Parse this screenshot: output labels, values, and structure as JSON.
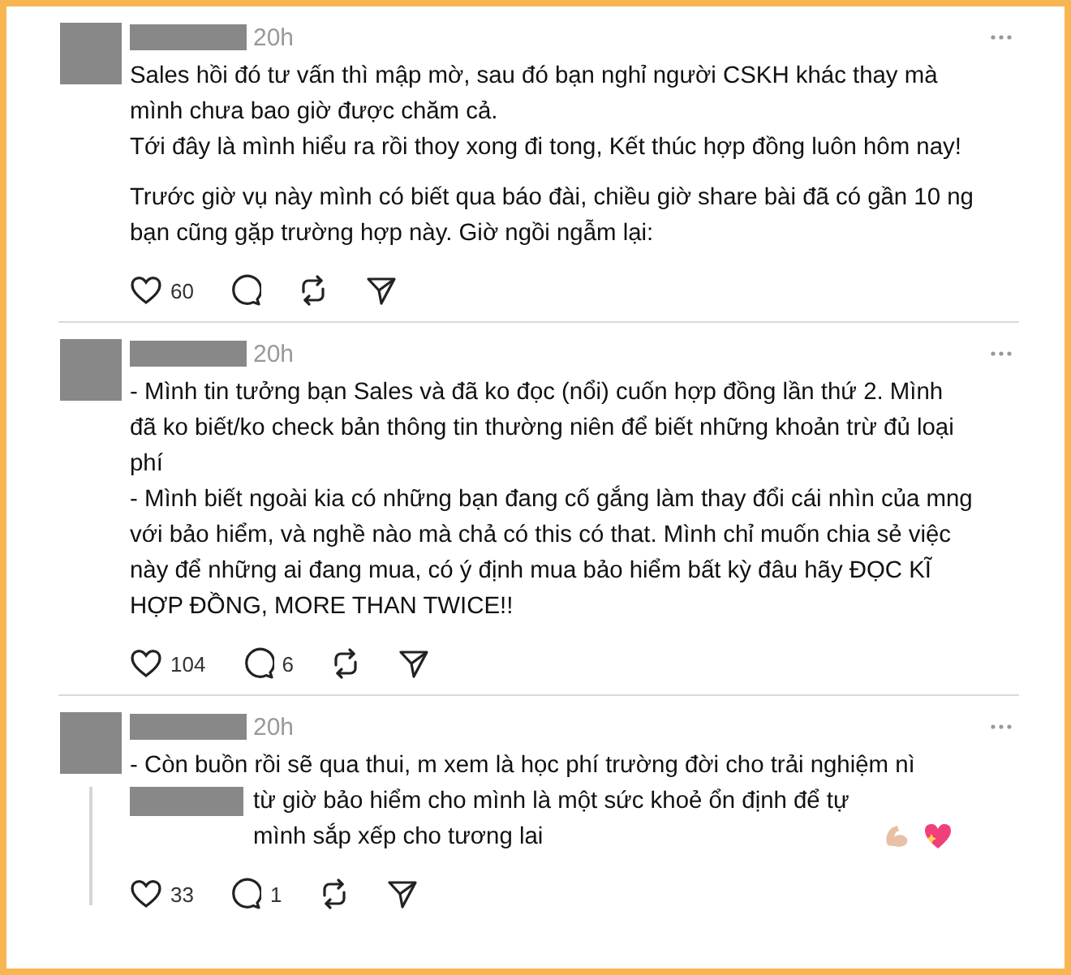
{
  "posts": [
    {
      "time": "20h",
      "has_thread_line": false,
      "redacted_prefix": false,
      "has_emoji": false,
      "paragraphs": [
        [
          "Sales hồi đó tư vấn thì mập mờ, sau đó bạn nghỉ người CSKH khác thay mà mình chưa bao giờ được chăm cả.",
          "Tới đây là mình hiểu ra rồi thoy xong đi tong, Kết thúc hợp đồng luôn hôm nay!"
        ],
        [
          "Trước giờ vụ này mình có biết qua báo đài, chiều giờ share bài đã có gần 10 ng bạn cũng gặp trường hợp này. Giờ ngồi ngẫm lại:"
        ]
      ],
      "likes": "60"
    },
    {
      "time": "20h",
      "has_thread_line": false,
      "redacted_prefix": false,
      "has_emoji": false,
      "paragraphs": [
        [
          "- Mình tin tưởng bạn Sales và đã ko đọc (nổi) cuốn hợp đồng lần thứ 2. Mình đã ko biết/ko check bản thông tin thường niên để biết những khoản trừ đủ loại phí",
          "- Mình biết ngoài kia có những bạn đang cố gắng làm thay đổi cái nhìn của mng với bảo hiểm, và nghề nào mà chả có this có that. Mình chỉ muốn chia sẻ việc này để những ai đang mua, có ý định mua bảo hiểm bất kỳ đâu hãy ĐỌC KĨ HỢP ĐỒNG, MORE THAN TWICE!!"
        ]
      ],
      "likes": "104",
      "replies": "6"
    },
    {
      "time": "20h",
      "has_thread_line": true,
      "redacted_prefix": true,
      "has_emoji": true,
      "paragraphs": [
        [
          "- Còn buồn rồi sẽ qua thui, m xem là học phí trường đời cho trải nghiệm nì",
          "từ giờ bảo hiểm cho mình là một sức khoẻ ổn định để tự mình sắp xếp cho tương lai"
        ]
      ],
      "likes": "33",
      "replies": "1"
    }
  ]
}
